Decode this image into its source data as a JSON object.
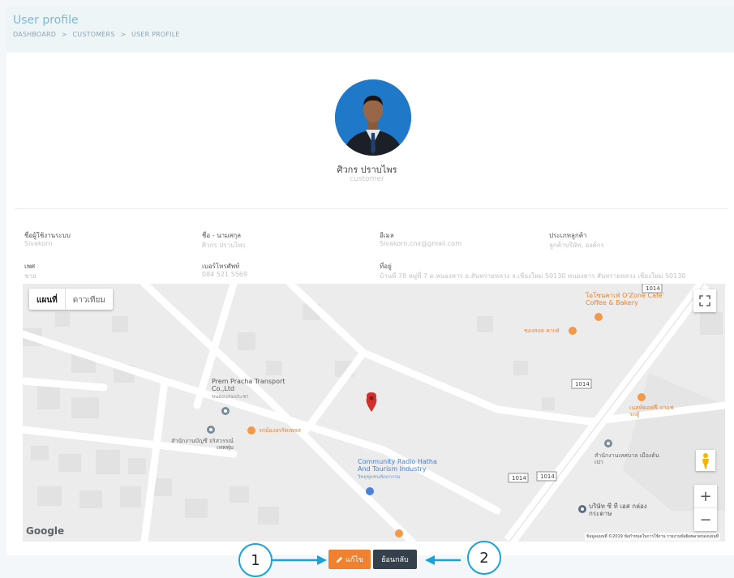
{
  "header": {
    "title": "User profile",
    "breadcrumbs": [
      "DASHBOARD",
      ">",
      "CUSTOMERS",
      ">",
      "USER PROFILE"
    ]
  },
  "profile": {
    "name": "ศิวกร ปราบไพร",
    "role": "customer"
  },
  "fields": [
    {
      "label": "ชื่อผู้ใช้งานระบบ",
      "value": "Sivakorn"
    },
    {
      "label": "ชื่อ - นามสกุล",
      "value": "ศิวกร ปราบไพร"
    },
    {
      "label": "อีเมล",
      "value": "Sivakorn.cnx@gmail.com"
    },
    {
      "label": "ประเภทลูกค้า",
      "value": "ลูกค้าบริษัท, องค์กร"
    },
    {
      "label": "เพศ",
      "value": "ชาย"
    },
    {
      "label": "เบอร์โทรศัพท์",
      "value": "084 521 5569"
    },
    {
      "label": "ที่อยู่",
      "value": "บ้านที่ 78 หมู่ที่ 7 ต.หนองหาร อ.สันทรายหลวง จ.เชียงใหม่ 50130 หนองหาร สันทรายหลวง เชียงใหม่ 50130"
    }
  ],
  "map": {
    "tabs": [
      "แผนที่",
      "ดาวเทียม"
    ],
    "places": {
      "prem": "Prem Pracha Transport Co.,Ltd",
      "prem_th": "ขนส่งเปรมประชา",
      "ozone": "โอโซนคาเฟ่ O'Zone Cafe' Coffee & Bakery",
      "cafe": "ของลอย คาเฟ่",
      "radio": "Community Radio Hatha And Tourism Industry",
      "radio_th": "วิทยุชุมชนหัตถกรรม",
      "accounting": "สำนักงานบัญชี จริสวรรณ์ เทพพุ่ม",
      "shop": "รถบ้องอรรัตเพลส",
      "coffee": "เนสท์คอฟฟี่ กาแฟรถตู้",
      "municipal": "สำนักงานเทศบาล เมืองต้นเปา",
      "company": "บริษัท ซี ที เอส กล่องกระดาษ"
    },
    "roads": [
      "1014",
      "1014",
      "1014",
      "1014"
    ],
    "google": "Google",
    "footer": "ข้อมูลแผนที่ ©2019   ข้อกำหนดในการใช้งาน   รายงานข้อผิดพลาดของแผนที่",
    "zoom_in": "+",
    "zoom_out": "−"
  },
  "actions": {
    "edit": "แก้ไข",
    "back": "ย้อนกลับ"
  },
  "annotations": [
    "1",
    "2"
  ],
  "colors": {
    "edit": "#f0812e",
    "back": "#34404b",
    "accent": "#1aa3d9",
    "pin": "#d0312d"
  }
}
